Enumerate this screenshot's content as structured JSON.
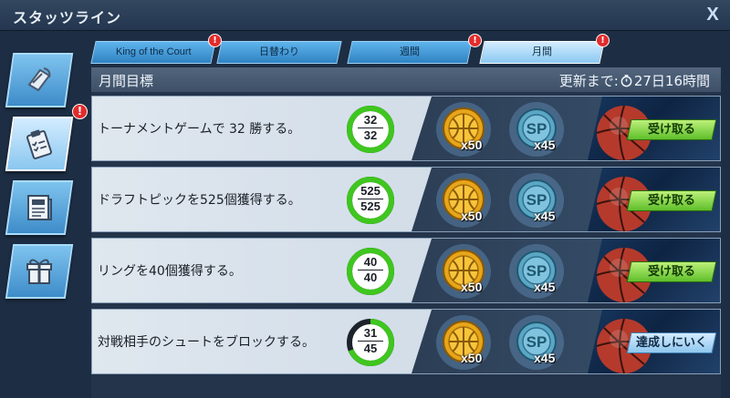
{
  "window": {
    "title": "スタッツライン",
    "close_label": "X"
  },
  "sidebar": {
    "items": [
      {
        "name": "sidebar-item-overview",
        "icon": "scroll-icon",
        "active": false,
        "badge": ""
      },
      {
        "name": "sidebar-item-missions",
        "icon": "clipboard-icon",
        "active": true,
        "badge": "!"
      },
      {
        "name": "sidebar-item-news",
        "icon": "newspaper-icon",
        "active": false,
        "badge": ""
      },
      {
        "name": "sidebar-item-gifts",
        "icon": "gift-icon",
        "active": false,
        "badge": ""
      }
    ]
  },
  "tabs": [
    {
      "label": "King of the Court",
      "badge": "!",
      "active": false
    },
    {
      "label": "日替わり",
      "badge": "",
      "active": false
    },
    {
      "label": "週間",
      "badge": "!",
      "active": false
    },
    {
      "label": "月間",
      "badge": "!",
      "active": true
    }
  ],
  "panel": {
    "title": "月間目標",
    "refresh_label": "更新まで:",
    "refresh_icon": "timer-icon",
    "refresh_time": "27日16時間"
  },
  "missions": [
    {
      "text": "トーナメントゲームで 32 勝する。",
      "current": "32",
      "target": "32",
      "progress": 1.0,
      "reward1_icon": "basketball-coin-icon",
      "reward1_count": "x50",
      "reward2_icon": "sp-token-icon",
      "reward2_count": "x45",
      "action": "受け取る",
      "action_type": "claim"
    },
    {
      "text": "ドラフトピックを525個獲得する。",
      "current": "525",
      "target": "525",
      "progress": 1.0,
      "reward1_icon": "basketball-coin-icon",
      "reward1_count": "x50",
      "reward2_icon": "sp-token-icon",
      "reward2_count": "x45",
      "action": "受け取る",
      "action_type": "claim"
    },
    {
      "text": "リングを40個獲得する。",
      "current": "40",
      "target": "40",
      "progress": 1.0,
      "reward1_icon": "basketball-coin-icon",
      "reward1_count": "x50",
      "reward2_icon": "sp-token-icon",
      "reward2_count": "x45",
      "action": "受け取る",
      "action_type": "claim"
    },
    {
      "text": "対戦相手のシュートをブロックする。",
      "current": "31",
      "target": "45",
      "progress": 0.689,
      "reward1_icon": "basketball-coin-icon",
      "reward1_count": "x50",
      "reward2_icon": "sp-token-icon",
      "reward2_count": "x45",
      "action": "達成しにいく",
      "action_type": "go"
    }
  ],
  "colors": {
    "accent": "#3f9be0",
    "progress_green": "#3fc61f",
    "claim_green": "#7dd63f",
    "badge_red": "#e42b2b"
  }
}
